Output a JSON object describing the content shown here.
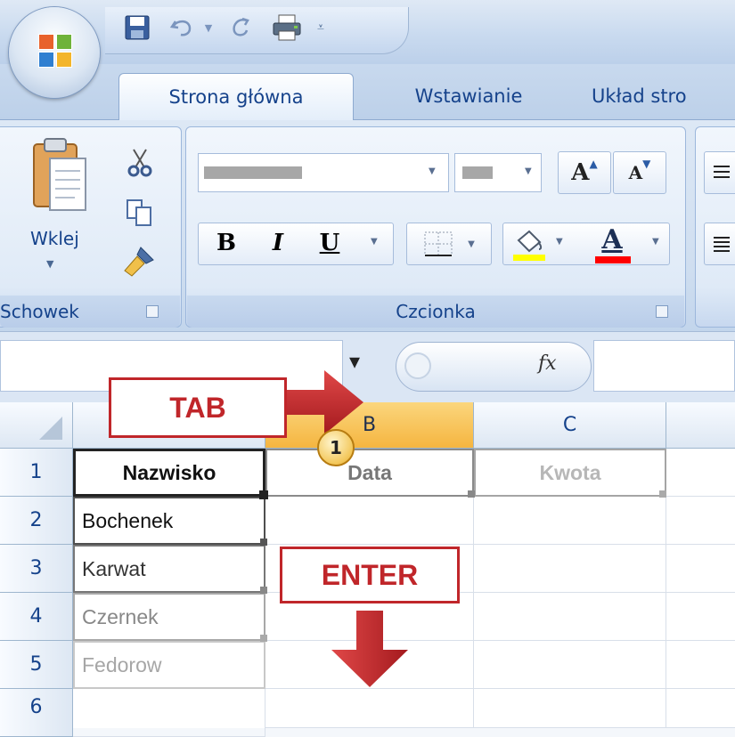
{
  "ribbon": {
    "tabs": [
      {
        "label": "Strona główna",
        "active": true
      },
      {
        "label": "Wstawianie",
        "active": false
      },
      {
        "label": "Układ stro",
        "active": false
      }
    ],
    "clipboard": {
      "paste_label": "Wklej",
      "group_label": "Schowek"
    },
    "font": {
      "group_label": "Czcionka",
      "bold": "B",
      "italic": "I",
      "underline": "U",
      "grow": "A",
      "shrink": "A",
      "font_color_letter": "A"
    }
  },
  "formula_bar": {
    "fx": "fx",
    "name_box_value": "",
    "formula_value": ""
  },
  "sheet": {
    "columns": [
      "B",
      "C"
    ],
    "selected_column": "B",
    "rows": [
      {
        "num": "1",
        "a": "Nazwisko",
        "b": "Data",
        "c": "Kwota"
      },
      {
        "num": "2",
        "a": "Bochenek",
        "b": "",
        "c": ""
      },
      {
        "num": "3",
        "a": "Karwat",
        "b": "",
        "c": ""
      },
      {
        "num": "4",
        "a": "Czernek",
        "b": "",
        "c": ""
      },
      {
        "num": "5",
        "a": "Fedorow",
        "b": "",
        "c": ""
      },
      {
        "num": "6",
        "a": "",
        "b": "",
        "c": ""
      }
    ]
  },
  "annotations": {
    "tab_label": "TAB",
    "enter_label": "ENTER",
    "step_number": "1",
    "accent_color": "#c0262a"
  },
  "icons": [
    "office-button-icon",
    "save-icon",
    "undo-icon",
    "redo-icon",
    "print-icon",
    "customize-qat-icon",
    "paste-icon",
    "cut-icon",
    "copy-icon",
    "format-painter-icon",
    "border-icon",
    "fill-color-icon",
    "font-color-icon",
    "align-icon",
    "name-box-dropdown-icon"
  ]
}
